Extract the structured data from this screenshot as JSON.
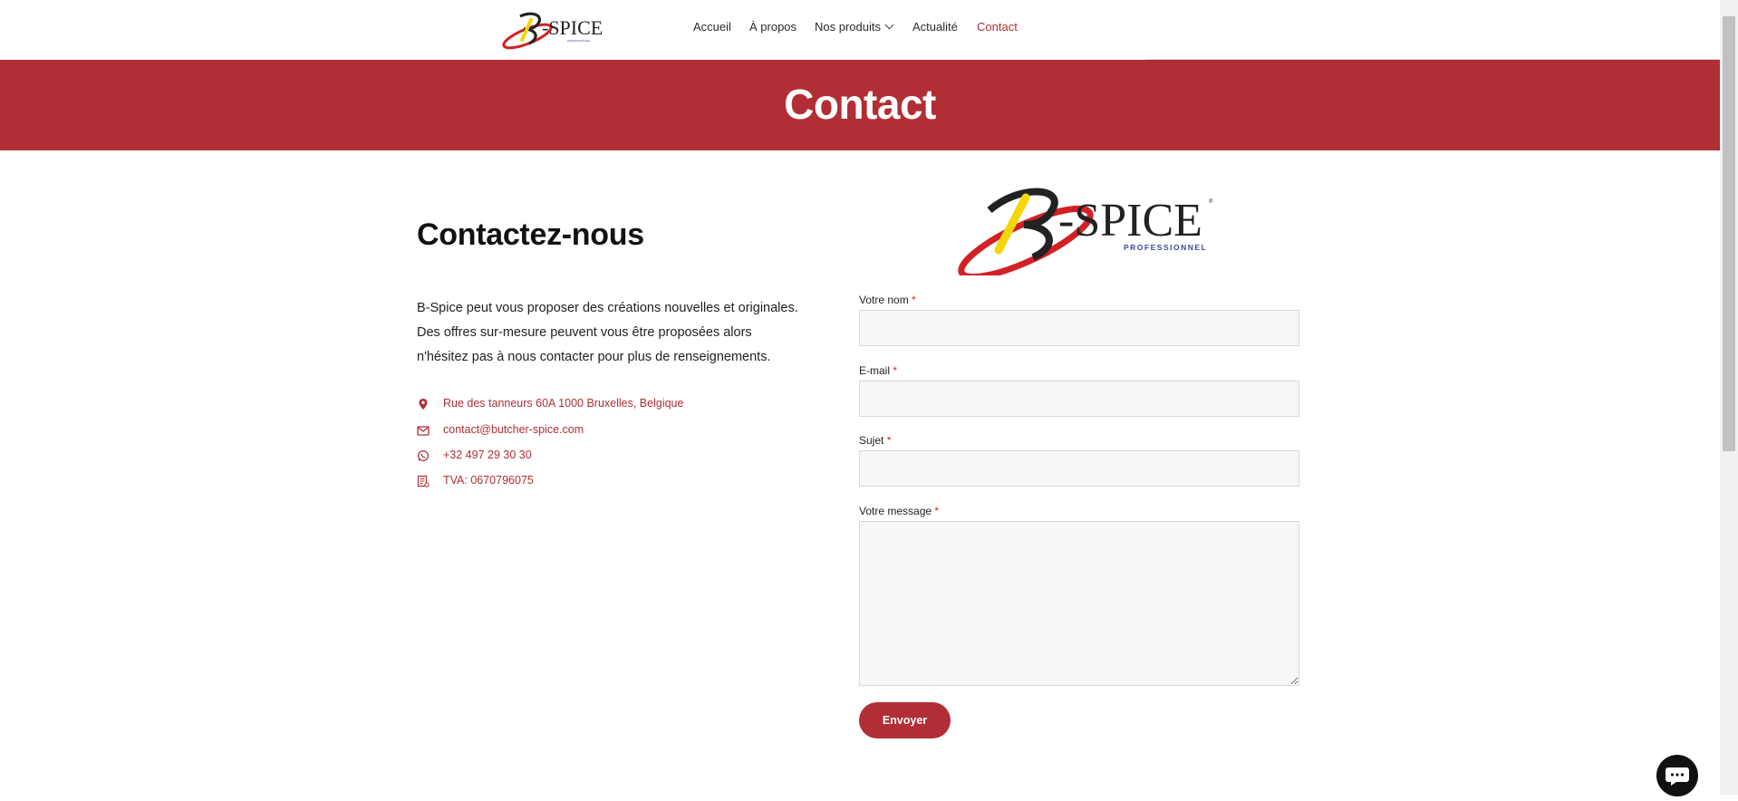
{
  "header": {
    "logo_alt": "B-SPICE",
    "nav": [
      {
        "label": "Accueil"
      },
      {
        "label": "À propos"
      },
      {
        "label": "Nos produits"
      },
      {
        "label": "Actualité"
      },
      {
        "label": "Contact"
      }
    ],
    "active_index": 4
  },
  "banner": {
    "title": "Contact"
  },
  "contact": {
    "heading": "Contactez-nous",
    "intro_lines": [
      "B-Spice peut vous proposer des créations nouvelles et originales.",
      "Des offres sur-mesure peuvent vous être proposées alors",
      "n'hésitez pas à nous contacter pour plus de renseignements."
    ],
    "address": "Rue des tanneurs 60A 1000 Bruxelles, Belgique",
    "email": "contact@butcher-spice.com",
    "phone": "+32 497 29 30 30",
    "vat": "TVA: 0670796075"
  },
  "form": {
    "logo_text": "-SPICE",
    "logo_sub": "PROFESSIONNEL",
    "name_label": "Votre nom",
    "email_label": "E-mail",
    "subject_label": "Sujet",
    "message_label": "Votre message",
    "required_mark": "*",
    "name_value": "",
    "email_value": "",
    "subject_value": "",
    "message_value": "",
    "submit_label": "Envoyer"
  },
  "colors": {
    "brand_red": "#b12e35",
    "logo_yellow": "#f4d60a",
    "logo_dark": "#222222",
    "logo_blue": "#3b4a9c"
  },
  "icons": {
    "address": "map-pin-icon",
    "email": "envelope-icon",
    "phone": "whatsapp-icon",
    "vat": "receipt-icon",
    "chat": "chat-bubble-icon"
  }
}
